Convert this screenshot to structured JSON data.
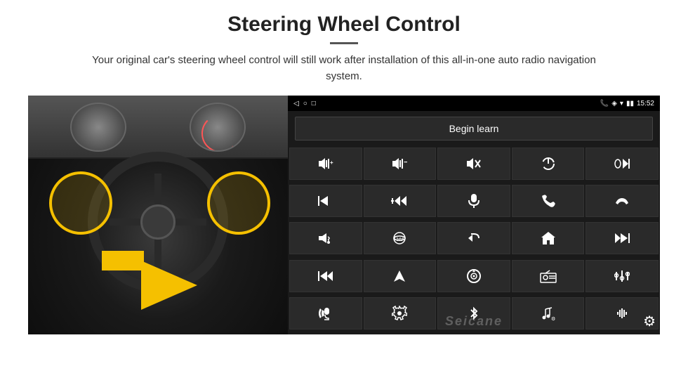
{
  "page": {
    "title": "Steering Wheel Control",
    "divider": true,
    "subtitle": "Your original car's steering wheel control will still work after installation of this all-in-one auto radio navigation system.",
    "statusbar": {
      "time": "15:52",
      "icons": [
        "📞",
        "📍",
        "📶"
      ]
    },
    "learn_button": {
      "label": "Begin learn"
    },
    "icon_grid": [
      {
        "icon": "🔊+",
        "label": "vol-up"
      },
      {
        "icon": "🔊−",
        "label": "vol-down"
      },
      {
        "icon": "🔇",
        "label": "mute"
      },
      {
        "icon": "⏻",
        "label": "power"
      },
      {
        "icon": "📞⏮",
        "label": "call-prev"
      },
      {
        "icon": "⏭",
        "label": "next-track"
      },
      {
        "icon": "⏪⏭",
        "label": "seek"
      },
      {
        "icon": "🎙",
        "label": "mic"
      },
      {
        "icon": "📞",
        "label": "call"
      },
      {
        "icon": "📞↩",
        "label": "hangup"
      },
      {
        "icon": "📢",
        "label": "horn"
      },
      {
        "icon": "🔄360",
        "label": "360"
      },
      {
        "icon": "↩",
        "label": "back"
      },
      {
        "icon": "🏠",
        "label": "home"
      },
      {
        "icon": "⏮⏮",
        "label": "rewind"
      },
      {
        "icon": "⏭⏭",
        "label": "fast-forward"
      },
      {
        "icon": "▶",
        "label": "navigate"
      },
      {
        "icon": "⏺",
        "label": "source"
      },
      {
        "icon": "📻",
        "label": "radio"
      },
      {
        "icon": "🎚",
        "label": "eq"
      },
      {
        "icon": "🎤",
        "label": "voice"
      },
      {
        "icon": "⚙",
        "label": "settings"
      },
      {
        "icon": "✱",
        "label": "bluetooth"
      },
      {
        "icon": "🎵",
        "label": "music"
      },
      {
        "icon": "📊",
        "label": "volume-bar"
      }
    ],
    "watermark": "Seicane"
  }
}
